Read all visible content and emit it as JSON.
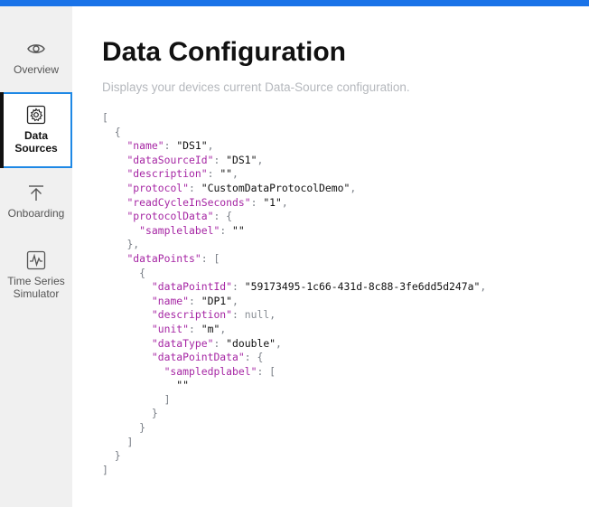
{
  "nav": {
    "items": [
      {
        "id": "overview",
        "label": "Overview",
        "icon": "eye-icon",
        "active": false
      },
      {
        "id": "data-sources",
        "label": "Data Sources",
        "icon": "gear-icon",
        "active": true
      },
      {
        "id": "onboarding",
        "label": "Onboarding",
        "icon": "upload-arrow-icon",
        "active": false
      },
      {
        "id": "ts-sim",
        "label": "Time Series Simulator",
        "icon": "waveform-icon",
        "active": false
      }
    ]
  },
  "page": {
    "title": "Data Configuration",
    "subtitle": "Displays your devices current Data-Source configuration."
  },
  "config": [
    {
      "name": "DS1",
      "dataSourceId": "DS1",
      "description": "",
      "protocol": "CustomDataProtocolDemo",
      "readCycleInSeconds": "1",
      "protocolData": {
        "samplelabel": ""
      },
      "dataPoints": [
        {
          "dataPointId": "59173495-1c66-431d-8c88-3fe6dd5d247a",
          "name": "DP1",
          "description": null,
          "unit": "m",
          "dataType": "double",
          "dataPointData": {
            "sampledplabel": [
              ""
            ]
          }
        }
      ]
    }
  ],
  "colors": {
    "accent": "#1a73e8",
    "active_border": "#1e88e5",
    "json_key": "#a626a4",
    "subtitle": "#b5b8bd"
  }
}
